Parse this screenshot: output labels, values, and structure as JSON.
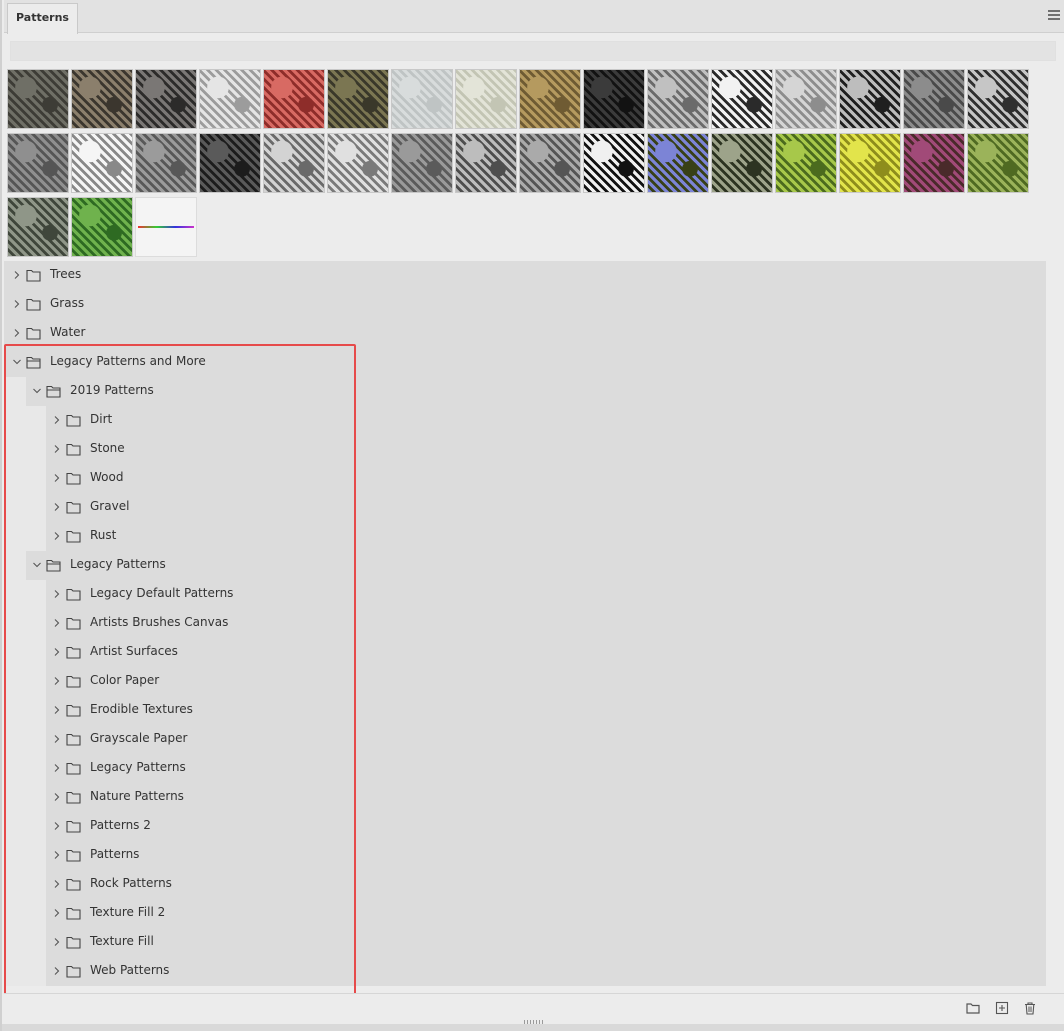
{
  "panel": {
    "tab_label": "Patterns"
  },
  "swatches": [
    {
      "c1": "#6f6f66",
      "c2": "#3d3c36"
    },
    {
      "c1": "#8b7f6c",
      "c2": "#3b362e"
    },
    {
      "c1": "#7a7775",
      "c2": "#2c2b2a"
    },
    {
      "c1": "#e5e5e5",
      "c2": "#9c9c9c"
    },
    {
      "c1": "#d86a63",
      "c2": "#8e2d2a"
    },
    {
      "c1": "#7b7652",
      "c2": "#3a382a"
    },
    {
      "c1": "#d8dcdc",
      "c2": "#bfc4c4"
    },
    {
      "c1": "#e3e4d8",
      "c2": "#c3c5b4"
    },
    {
      "c1": "#b59a5f",
      "c2": "#6f5b33"
    },
    {
      "c1": "#3b3b3b",
      "c2": "#121212"
    },
    {
      "c1": "#c0c0c0",
      "c2": "#6b6b6b"
    },
    {
      "c1": "#f2f2f2",
      "c2": "#2a2a2a"
    },
    {
      "c1": "#d5d5d5",
      "c2": "#8d8d8d"
    },
    {
      "c1": "#bdbdbd",
      "c2": "#1f1f1f"
    },
    {
      "c1": "#8c8c8c",
      "c2": "#4a4a4a"
    },
    {
      "c1": "#c6c6c6",
      "c2": "#2f2f2f"
    },
    {
      "c1": "#8f8f8f",
      "c2": "#555555"
    },
    {
      "c1": "#f5f5f5",
      "c2": "#888888"
    },
    {
      "c1": "#9b9b9b",
      "c2": "#585858"
    },
    {
      "c1": "#5a5a5a",
      "c2": "#1c1c1c"
    },
    {
      "c1": "#d3d3d3",
      "c2": "#6a6a6a"
    },
    {
      "c1": "#e0e0e0",
      "c2": "#7a7a7a"
    },
    {
      "c1": "#9a9a9a",
      "c2": "#5b5b5b"
    },
    {
      "c1": "#bdbdbd",
      "c2": "#4e4e4e"
    },
    {
      "c1": "#aaaaaa",
      "c2": "#555555"
    },
    {
      "c1": "#f0f0f0",
      "c2": "#111111"
    },
    {
      "c1": "#7c84d6",
      "c2": "#384017"
    },
    {
      "c1": "#9da38a",
      "c2": "#2c3321"
    },
    {
      "c1": "#a7c84a",
      "c2": "#4b6b1e"
    },
    {
      "c1": "#e2e44b",
      "c2": "#8e8d1c"
    },
    {
      "c1": "#a14a78",
      "c2": "#4a2a2a"
    },
    {
      "c1": "#9bb35a",
      "c2": "#4f6a22"
    },
    {
      "c1": "#8f9688",
      "c2": "#3f463b"
    },
    {
      "c1": "#6fb24d",
      "c2": "#2e6a22"
    },
    {
      "c1": "#f4f4f4",
      "c2": "#f4f4f4"
    }
  ],
  "tree": [
    {
      "label": "Trees",
      "level": 0,
      "expanded": false
    },
    {
      "label": "Grass",
      "level": 0,
      "expanded": false
    },
    {
      "label": "Water",
      "level": 0,
      "expanded": false
    },
    {
      "label": "Legacy Patterns and More",
      "level": 0,
      "expanded": true
    },
    {
      "label": "2019 Patterns",
      "level": 1,
      "expanded": true
    },
    {
      "label": "Dirt",
      "level": 2,
      "expanded": false
    },
    {
      "label": "Stone",
      "level": 2,
      "expanded": false
    },
    {
      "label": "Wood",
      "level": 2,
      "expanded": false
    },
    {
      "label": "Gravel",
      "level": 2,
      "expanded": false
    },
    {
      "label": "Rust",
      "level": 2,
      "expanded": false
    },
    {
      "label": "Legacy Patterns",
      "level": 1,
      "expanded": true
    },
    {
      "label": "Legacy Default Patterns",
      "level": 2,
      "expanded": false
    },
    {
      "label": "Artists Brushes Canvas",
      "level": 2,
      "expanded": false
    },
    {
      "label": "Artist Surfaces",
      "level": 2,
      "expanded": false
    },
    {
      "label": "Color Paper",
      "level": 2,
      "expanded": false
    },
    {
      "label": "Erodible Textures",
      "level": 2,
      "expanded": false
    },
    {
      "label": "Grayscale Paper",
      "level": 2,
      "expanded": false
    },
    {
      "label": "Legacy Patterns",
      "level": 2,
      "expanded": false
    },
    {
      "label": "Nature Patterns",
      "level": 2,
      "expanded": false
    },
    {
      "label": "Patterns 2",
      "level": 2,
      "expanded": false
    },
    {
      "label": "Patterns",
      "level": 2,
      "expanded": false
    },
    {
      "label": "Rock Patterns",
      "level": 2,
      "expanded": false
    },
    {
      "label": "Texture Fill 2",
      "level": 2,
      "expanded": false
    },
    {
      "label": "Texture Fill",
      "level": 2,
      "expanded": false
    },
    {
      "label": "Web Patterns",
      "level": 2,
      "expanded": false
    }
  ],
  "icons": {
    "menu": "hamburger-menu-icon",
    "folder": "folder-icon",
    "folder_open": "folder-open-icon",
    "chevron_right": "chevron-right-icon",
    "chevron_down": "chevron-down-icon",
    "new_group": "new-folder-icon",
    "new_pattern": "add-icon",
    "delete": "trash-icon"
  },
  "colors": {
    "highlight": "#e64a4a",
    "panel_bg": "#ececec",
    "tree_bg": "#dcdcdc"
  }
}
